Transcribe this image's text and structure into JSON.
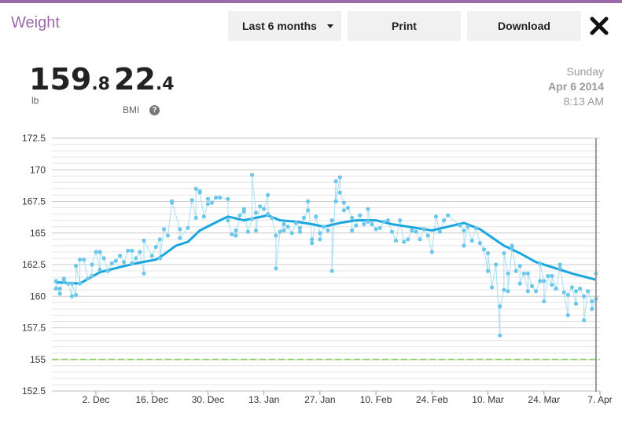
{
  "header": {
    "title": "Weight",
    "range_label": "Last 6 months",
    "print_label": "Print",
    "download_label": "Download"
  },
  "stats": {
    "weight_int": "159",
    "weight_dec": ".8",
    "weight_unit": "lb",
    "bmi_int": "22",
    "bmi_dec": ".4",
    "bmi_label": "BMI",
    "help_symbol": "?"
  },
  "selected_date": {
    "day": "Sunday",
    "date": "Apr 6 2014",
    "time": "8:13 AM"
  },
  "colors": {
    "accent": "#9c6aa8",
    "trend": "#1aa6df",
    "points": "#6cc7ec",
    "goal": "#8fd36a"
  },
  "chart_data": {
    "type": "line",
    "title": "",
    "xlabel": "",
    "ylabel": "",
    "ylim": [
      152.5,
      172.5
    ],
    "y_ticks": [
      "152.5",
      "155",
      "157.5",
      "160",
      "162.5",
      "165",
      "167.5",
      "170",
      "172.5"
    ],
    "x_ticks": [
      "2. Dec",
      "16. Dec",
      "30. Dec",
      "13. Jan",
      "27. Jan",
      "10. Feb",
      "24. Feb",
      "10. Mar",
      "24. Mar",
      "7. Apr"
    ],
    "xlim": [
      "2013-11-21",
      "2014-04-07"
    ],
    "goal": 155,
    "grid": true,
    "series": [
      {
        "kind": "measurements",
        "points": [
          [
            "2013-11-22",
            160.6
          ],
          [
            "2013-11-22",
            161.2
          ],
          [
            "2013-11-23",
            160.2
          ],
          [
            "2013-11-23",
            160.6
          ],
          [
            "2013-11-24",
            161.4
          ],
          [
            "2013-11-24",
            161.2
          ],
          [
            "2013-11-25",
            161.0
          ],
          [
            "2013-11-26",
            160.0
          ],
          [
            "2013-11-26",
            161.0
          ],
          [
            "2013-11-27",
            160.1
          ],
          [
            "2013-11-27",
            162.4
          ],
          [
            "2013-11-28",
            161.0
          ],
          [
            "2013-11-28",
            162.9
          ],
          [
            "2013-11-29",
            162.9
          ],
          [
            "2013-11-30",
            161.4
          ],
          [
            "2013-12-01",
            161.6
          ],
          [
            "2013-12-01",
            162.5
          ],
          [
            "2013-12-02",
            163.5
          ],
          [
            "2013-12-03",
            162.1
          ],
          [
            "2013-12-03",
            163.5
          ],
          [
            "2013-12-04",
            163.0
          ],
          [
            "2013-12-05",
            162.0
          ],
          [
            "2013-12-06",
            162.6
          ],
          [
            "2013-12-07",
            162.8
          ],
          [
            "2013-12-08",
            163.2
          ],
          [
            "2013-12-09",
            162.7
          ],
          [
            "2013-12-10",
            163.6
          ],
          [
            "2013-12-11",
            163.6
          ],
          [
            "2013-12-11",
            162.6
          ],
          [
            "2013-12-12",
            163.0
          ],
          [
            "2013-12-13",
            163.5
          ],
          [
            "2013-12-14",
            161.8
          ],
          [
            "2013-12-14",
            164.4
          ],
          [
            "2013-12-16",
            163.2
          ],
          [
            "2013-12-17",
            163.9
          ],
          [
            "2013-12-18",
            164.5
          ],
          [
            "2013-12-18",
            163.0
          ],
          [
            "2013-12-19",
            165.3
          ],
          [
            "2013-12-20",
            164.8
          ],
          [
            "2013-12-21",
            167.4
          ],
          [
            "2013-12-21",
            167.5
          ],
          [
            "2013-12-23",
            165.3
          ],
          [
            "2013-12-23",
            164.6
          ],
          [
            "2013-12-25",
            165.4
          ],
          [
            "2013-12-26",
            167.6
          ],
          [
            "2013-12-27",
            166.2
          ],
          [
            "2013-12-27",
            168.5
          ],
          [
            "2013-12-28",
            168.3
          ],
          [
            "2013-12-28",
            168.2
          ],
          [
            "2013-12-29",
            166.3
          ],
          [
            "2013-12-30",
            167.3
          ],
          [
            "2013-12-30",
            167.7
          ],
          [
            "2013-12-31",
            167.4
          ],
          [
            "2014-01-01",
            167.8
          ],
          [
            "2014-01-02",
            167.8
          ],
          [
            "2014-01-04",
            167.7
          ],
          [
            "2014-01-04",
            166.0
          ],
          [
            "2014-01-05",
            164.9
          ],
          [
            "2014-01-06",
            165.2
          ],
          [
            "2014-01-06",
            164.8
          ],
          [
            "2014-01-07",
            166.4
          ],
          [
            "2014-01-08",
            166.7
          ],
          [
            "2014-01-08",
            166.9
          ],
          [
            "2014-01-09",
            165.1
          ],
          [
            "2014-01-10",
            166.1
          ],
          [
            "2014-01-10",
            169.6
          ],
          [
            "2014-01-11",
            166.6
          ],
          [
            "2014-01-11",
            165.2
          ],
          [
            "2014-01-12",
            167.1
          ],
          [
            "2014-01-13",
            166.9
          ],
          [
            "2014-01-14",
            168.0
          ],
          [
            "2014-01-14",
            166.5
          ],
          [
            "2014-01-15",
            166.2
          ],
          [
            "2014-01-16",
            164.8
          ],
          [
            "2014-01-16",
            162.2
          ],
          [
            "2014-01-17",
            165.1
          ],
          [
            "2014-01-18",
            165.7
          ],
          [
            "2014-01-18",
            165.2
          ],
          [
            "2014-01-19",
            165.5
          ],
          [
            "2014-01-20",
            165.0
          ],
          [
            "2014-01-21",
            165.8
          ],
          [
            "2014-01-22",
            165.4
          ],
          [
            "2014-01-22",
            165.1
          ],
          [
            "2014-01-23",
            166.2
          ],
          [
            "2014-01-24",
            166.8
          ],
          [
            "2014-01-24",
            167.5
          ],
          [
            "2014-01-25",
            164.5
          ],
          [
            "2014-01-25",
            164.2
          ],
          [
            "2014-01-26",
            166.3
          ],
          [
            "2014-01-27",
            165.0
          ],
          [
            "2014-01-27",
            164.5
          ],
          [
            "2014-01-28",
            165.5
          ],
          [
            "2014-01-29",
            165.2
          ],
          [
            "2014-01-30",
            166.0
          ],
          [
            "2014-01-30",
            162.0
          ],
          [
            "2014-01-31",
            169.1
          ],
          [
            "2014-01-31",
            167.5
          ],
          [
            "2014-02-01",
            169.4
          ],
          [
            "2014-02-01",
            168.2
          ],
          [
            "2014-02-02",
            167.4
          ],
          [
            "2014-02-02",
            166.8
          ],
          [
            "2014-02-03",
            167.0
          ],
          [
            "2014-02-04",
            166.2
          ],
          [
            "2014-02-04",
            165.2
          ],
          [
            "2014-02-05",
            165.6
          ],
          [
            "2014-02-06",
            166.4
          ],
          [
            "2014-02-07",
            165.7
          ],
          [
            "2014-02-08",
            165.9
          ],
          [
            "2014-02-08",
            166.9
          ],
          [
            "2014-02-09",
            165.7
          ],
          [
            "2014-02-10",
            165.3
          ],
          [
            "2014-02-11",
            165.4
          ],
          [
            "2014-02-12",
            165.9
          ],
          [
            "2014-02-13",
            166.0
          ],
          [
            "2014-02-14",
            165.1
          ],
          [
            "2014-02-15",
            164.4
          ],
          [
            "2014-02-16",
            166.0
          ],
          [
            "2014-02-17",
            164.3
          ],
          [
            "2014-02-18",
            164.5
          ],
          [
            "2014-02-19",
            165.2
          ],
          [
            "2014-02-20",
            165.1
          ],
          [
            "2014-02-21",
            164.5
          ],
          [
            "2014-02-22",
            165.3
          ],
          [
            "2014-02-23",
            164.8
          ],
          [
            "2014-02-24",
            163.5
          ],
          [
            "2014-02-25",
            166.3
          ],
          [
            "2014-02-26",
            165.1
          ],
          [
            "2014-02-27",
            166.0
          ],
          [
            "2014-02-28",
            166.4
          ],
          [
            "2014-03-03",
            165.6
          ],
          [
            "2014-03-04",
            165.2
          ],
          [
            "2014-03-04",
            164.0
          ],
          [
            "2014-03-05",
            165.5
          ],
          [
            "2014-03-06",
            164.4
          ],
          [
            "2014-03-07",
            165.4
          ],
          [
            "2014-03-08",
            164.2
          ],
          [
            "2014-03-09",
            163.7
          ],
          [
            "2014-03-10",
            162.0
          ],
          [
            "2014-03-10",
            163.4
          ],
          [
            "2014-03-11",
            160.7
          ],
          [
            "2014-03-12",
            162.5
          ],
          [
            "2014-03-13",
            156.9
          ],
          [
            "2014-03-13",
            159.2
          ],
          [
            "2014-03-14",
            160.5
          ],
          [
            "2014-03-14",
            163.4
          ],
          [
            "2014-03-15",
            161.8
          ],
          [
            "2014-03-15",
            160.4
          ],
          [
            "2014-03-16",
            163.8
          ],
          [
            "2014-03-16",
            164.0
          ],
          [
            "2014-03-17",
            162.0
          ],
          [
            "2014-03-18",
            162.4
          ],
          [
            "2014-03-18",
            161.0
          ],
          [
            "2014-03-19",
            161.8
          ],
          [
            "2014-03-20",
            160.4
          ],
          [
            "2014-03-20",
            161.8
          ],
          [
            "2014-03-21",
            160.8
          ],
          [
            "2014-03-22",
            160.4
          ],
          [
            "2014-03-23",
            161.2
          ],
          [
            "2014-03-23",
            162.6
          ],
          [
            "2014-03-24",
            161.2
          ],
          [
            "2014-03-24",
            159.6
          ],
          [
            "2014-03-25",
            161.6
          ],
          [
            "2014-03-26",
            160.9
          ],
          [
            "2014-03-26",
            161.6
          ],
          [
            "2014-03-27",
            160.6
          ],
          [
            "2014-03-28",
            162.2
          ],
          [
            "2014-03-28",
            162.5
          ],
          [
            "2014-03-29",
            160.3
          ],
          [
            "2014-03-30",
            158.5
          ],
          [
            "2014-03-30",
            160.1
          ],
          [
            "2014-03-31",
            160.7
          ],
          [
            "2014-04-01",
            159.4
          ],
          [
            "2014-04-01",
            160.4
          ],
          [
            "2014-04-02",
            160.6
          ],
          [
            "2014-04-03",
            160.0
          ],
          [
            "2014-04-03",
            158.1
          ],
          [
            "2014-04-04",
            160.4
          ],
          [
            "2014-04-04",
            160.4
          ],
          [
            "2014-04-05",
            159.6
          ],
          [
            "2014-04-05",
            159.0
          ],
          [
            "2014-04-06",
            159.8
          ],
          [
            "2014-04-06",
            161.8
          ]
        ]
      },
      {
        "kind": "trend",
        "points": [
          [
            "2013-11-22",
            161.1
          ],
          [
            "2013-11-28",
            161.0
          ],
          [
            "2013-12-03",
            161.9
          ],
          [
            "2013-12-08",
            162.3
          ],
          [
            "2013-12-12",
            162.6
          ],
          [
            "2013-12-17",
            162.9
          ],
          [
            "2013-12-19",
            163.3
          ],
          [
            "2013-12-22",
            164.0
          ],
          [
            "2013-12-25",
            164.3
          ],
          [
            "2013-12-28",
            165.2
          ],
          [
            "2014-01-02",
            166.0
          ],
          [
            "2014-01-04",
            166.3
          ],
          [
            "2014-01-08",
            166.0
          ],
          [
            "2014-01-14",
            166.4
          ],
          [
            "2014-01-17",
            166.0
          ],
          [
            "2014-01-21",
            165.9
          ],
          [
            "2014-01-25",
            165.7
          ],
          [
            "2014-01-28",
            165.5
          ],
          [
            "2014-02-01",
            165.8
          ],
          [
            "2014-02-05",
            166.0
          ],
          [
            "2014-02-10",
            166.0
          ],
          [
            "2014-02-14",
            165.7
          ],
          [
            "2014-02-18",
            165.5
          ],
          [
            "2014-02-22",
            165.3
          ],
          [
            "2014-02-24",
            165.2
          ],
          [
            "2014-02-28",
            165.5
          ],
          [
            "2014-03-04",
            165.8
          ],
          [
            "2014-03-08",
            165.3
          ],
          [
            "2014-03-14",
            164.0
          ],
          [
            "2014-03-18",
            163.4
          ],
          [
            "2014-03-22",
            162.7
          ],
          [
            "2014-03-26",
            162.3
          ],
          [
            "2014-03-31",
            161.8
          ],
          [
            "2014-04-06",
            161.3
          ]
        ]
      }
    ]
  }
}
